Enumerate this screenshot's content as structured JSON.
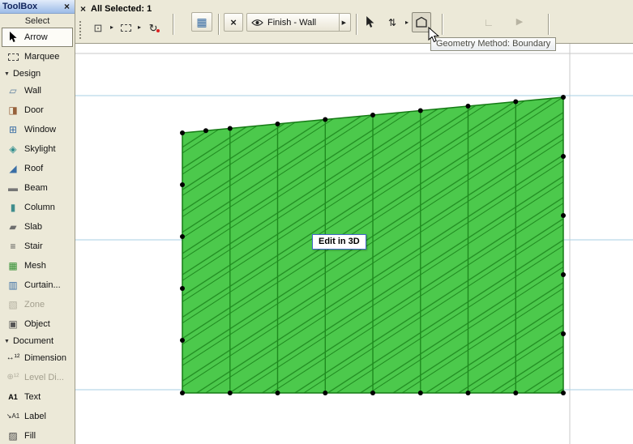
{
  "toolbox": {
    "title": "ToolBox",
    "close": "×",
    "subtitle": "Select",
    "select_tools": [
      {
        "label": "Arrow"
      },
      {
        "label": "Marquee"
      }
    ],
    "design": {
      "label": "Design",
      "tools": [
        "Wall",
        "Door",
        "Window",
        "Skylight",
        "Roof",
        "Beam",
        "Column",
        "Slab",
        "Stair",
        "Mesh",
        "Curtain...",
        "Zone",
        "Object"
      ]
    },
    "document": {
      "label": "Document",
      "tools": [
        "Dimension",
        "Level Di...",
        "Text",
        "Label",
        "Fill"
      ]
    }
  },
  "toolbar": {
    "close": "×",
    "status": "All Selected: 1",
    "finish_label": "Finish - Wall",
    "tooltip": "Geometry Method: Boundary"
  },
  "canvas": {
    "edit_label": "Edit in 3D"
  },
  "icons": {
    "section_arrow": "▼",
    "split_arrow": "▸",
    "dropdown_arrow": "▶",
    "wall": "▱",
    "door": "◨",
    "window": "⊞",
    "skylight": "◈",
    "roof": "◢",
    "beam": "▬",
    "column": "▮",
    "slab": "▰",
    "stair": "≡",
    "mesh": "▦",
    "curtain_wall": "▥",
    "zone": "▧",
    "object": "▣",
    "dimension": "↔¹²",
    "level_dimension": "⊕¹²",
    "text": "A1",
    "label": "↘A1",
    "fill": "▨",
    "pet_palette": "⊡",
    "rotate": "↻",
    "grid": "▦",
    "stretch": "×",
    "offset": "⇅",
    "corner": "∟",
    "play": "▶"
  },
  "colors": {
    "fill_green": "#4cc94c",
    "hatch_green": "#1f8a1f",
    "story_blue": "#a7cfe3",
    "grid_gray": "#c9c9c9",
    "toolbar_bg": "#ece9d8"
  }
}
